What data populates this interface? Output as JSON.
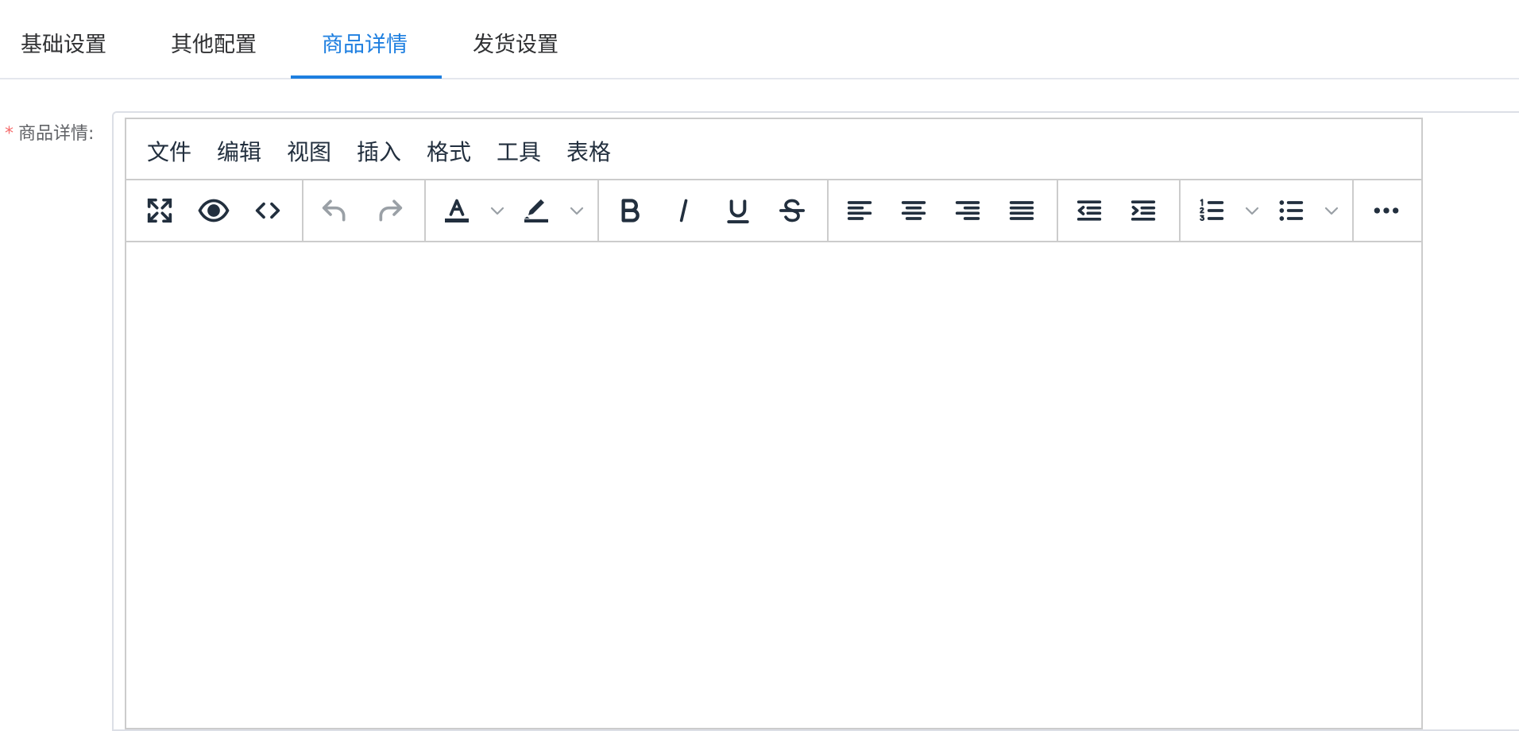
{
  "tabs": [
    {
      "label": "基础设置",
      "active": false
    },
    {
      "label": "其他配置",
      "active": false
    },
    {
      "label": "商品详情",
      "active": true
    },
    {
      "label": "发货设置",
      "active": false
    }
  ],
  "form": {
    "required_mark": "*",
    "label": "商品详情:"
  },
  "editor": {
    "menubar": [
      "文件",
      "编辑",
      "视图",
      "插入",
      "格式",
      "工具",
      "表格"
    ],
    "toolbar_icons": [
      "fullscreen-icon",
      "preview-icon",
      "code-icon",
      "undo-icon",
      "redo-icon",
      "text-color-icon",
      "highlight-color-icon",
      "bold-icon",
      "italic-icon",
      "underline-icon",
      "strikethrough-icon",
      "align-left-icon",
      "align-center-icon",
      "align-right-icon",
      "align-justify-icon",
      "outdent-icon",
      "indent-icon",
      "numbered-list-icon",
      "bullet-list-icon",
      "more-icon"
    ],
    "colors": {
      "accent": "#1e7fe0",
      "icon": "#222f3e",
      "disabled_icon": "#9aa0a6",
      "required": "#f56c6c",
      "border": "#cccccc"
    }
  }
}
